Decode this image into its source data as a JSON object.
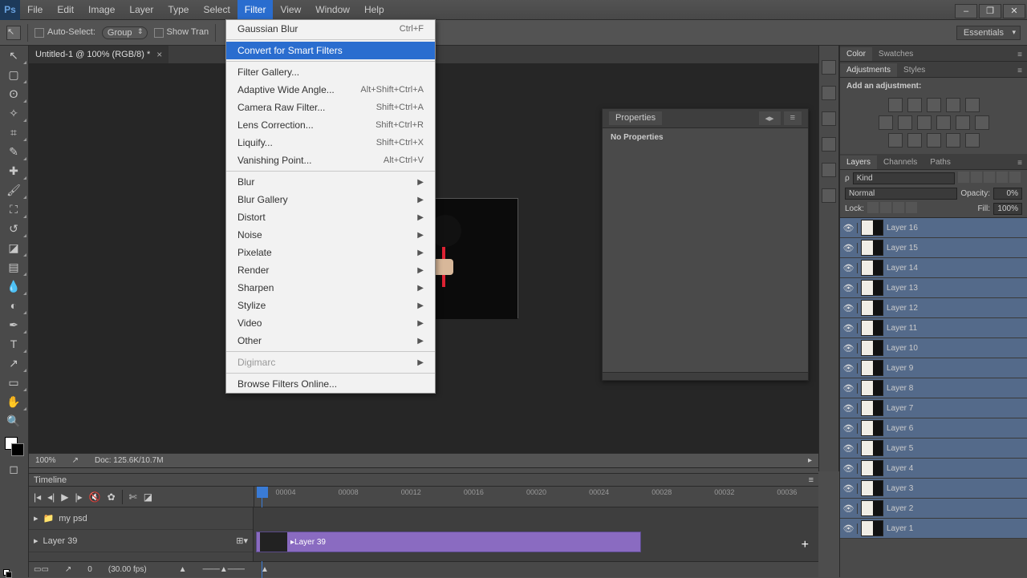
{
  "menubar": {
    "items": [
      "File",
      "Edit",
      "Image",
      "Layer",
      "Type",
      "Select",
      "Filter",
      "View",
      "Window",
      "Help"
    ],
    "active_index": 6
  },
  "window_controls": [
    "–",
    "❐",
    "✕"
  ],
  "optionsbar": {
    "auto_select": "Auto-Select:",
    "group": "Group",
    "show_transform": "Show Tran"
  },
  "essentials": "Essentials",
  "doc_tab": {
    "title": "Untitled-1 @ 100% (RGB/8) *"
  },
  "properties": {
    "title": "Properties",
    "body": "No Properties"
  },
  "statusbar": {
    "zoom": "100%",
    "doc": "Doc: 125.6K/10.7M"
  },
  "timeline": {
    "title": "Timeline",
    "ticks": [
      "00004",
      "00008",
      "00012",
      "00016",
      "00020",
      "00024",
      "00028",
      "00032",
      "00036"
    ],
    "group": "my psd",
    "track": "Layer 39",
    "clip": "Layer 39",
    "frame": "0",
    "fps": "(30.00 fps)"
  },
  "right": {
    "top_tabs": [
      "Color",
      "Swatches"
    ],
    "adj_tabs": [
      "Adjustments",
      "Styles"
    ],
    "adj_label": "Add an adjustment:",
    "layer_tabs": [
      "Layers",
      "Channels",
      "Paths"
    ],
    "kind": "Kind",
    "blend": "Normal",
    "opacity_label": "Opacity:",
    "opacity_val": "0%",
    "lock_label": "Lock:",
    "fill_label": "Fill:",
    "fill_val": "100%",
    "layers": [
      "Layer 16",
      "Layer 15",
      "Layer 14",
      "Layer 13",
      "Layer 12",
      "Layer 11",
      "Layer 10",
      "Layer 9",
      "Layer 8",
      "Layer 7",
      "Layer 6",
      "Layer 5",
      "Layer 4",
      "Layer 3",
      "Layer 2",
      "Layer 1"
    ]
  },
  "filter_menu": {
    "last": {
      "label": "Gaussian Blur",
      "shortcut": "Ctrl+F"
    },
    "smart": "Convert for Smart Filters",
    "group1": [
      {
        "label": "Filter Gallery..."
      },
      {
        "label": "Adaptive Wide Angle...",
        "shortcut": "Alt+Shift+Ctrl+A"
      },
      {
        "label": "Camera Raw Filter...",
        "shortcut": "Shift+Ctrl+A"
      },
      {
        "label": "Lens Correction...",
        "shortcut": "Shift+Ctrl+R"
      },
      {
        "label": "Liquify...",
        "shortcut": "Shift+Ctrl+X"
      },
      {
        "label": "Vanishing Point...",
        "shortcut": "Alt+Ctrl+V"
      }
    ],
    "subgroup": [
      "Blur",
      "Blur Gallery",
      "Distort",
      "Noise",
      "Pixelate",
      "Render",
      "Sharpen",
      "Stylize",
      "Video",
      "Other"
    ],
    "digimarc": "Digimarc",
    "browse": "Browse Filters Online..."
  }
}
